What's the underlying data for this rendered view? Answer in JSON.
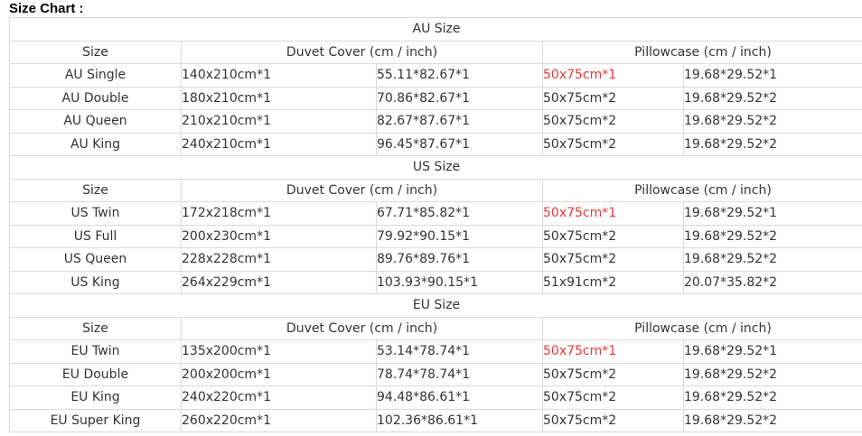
{
  "title": "Size Chart :",
  "header": {
    "size": "Size",
    "duvet": "Duvet Cover (cm / inch)",
    "pillow": "Pillowcase (cm / inch)"
  },
  "sections": [
    {
      "name": "AU Size",
      "rows": [
        {
          "size": "AU Single",
          "duvet_cm": "140x210cm*1",
          "duvet_in": "55.11*82.67*1",
          "pillow_cm": "50x75cm*1",
          "pillow_in": "19.68*29.52*1",
          "pillow_cm_highlight": true
        },
        {
          "size": "AU Double",
          "duvet_cm": "180x210cm*1",
          "duvet_in": "70.86*82.67*1",
          "pillow_cm": "50x75cm*2",
          "pillow_in": "19.68*29.52*2",
          "pillow_cm_highlight": false
        },
        {
          "size": "AU Queen",
          "duvet_cm": "210x210cm*1",
          "duvet_in": "82.67*87.67*1",
          "pillow_cm": "50x75cm*2",
          "pillow_in": "19.68*29.52*2",
          "pillow_cm_highlight": false
        },
        {
          "size": "AU King",
          "duvet_cm": "240x210cm*1",
          "duvet_in": "96.45*87.67*1",
          "pillow_cm": "50x75cm*2",
          "pillow_in": "19.68*29.52*2",
          "pillow_cm_highlight": false
        }
      ]
    },
    {
      "name": "US Size",
      "rows": [
        {
          "size": "US Twin",
          "duvet_cm": "172x218cm*1",
          "duvet_in": "67.71*85.82*1",
          "pillow_cm": "50x75cm*1",
          "pillow_in": "19.68*29.52*1",
          "pillow_cm_highlight": true
        },
        {
          "size": "US Full",
          "duvet_cm": "200x230cm*1",
          "duvet_in": "79.92*90.15*1",
          "pillow_cm": "50x75cm*2",
          "pillow_in": "19.68*29.52*2",
          "pillow_cm_highlight": false
        },
        {
          "size": "US Queen",
          "duvet_cm": "228x228cm*1",
          "duvet_in": "89.76*89.76*1",
          "pillow_cm": "50x75cm*2",
          "pillow_in": "19.68*29.52*2",
          "pillow_cm_highlight": false
        },
        {
          "size": "US King",
          "duvet_cm": "264x229cm*1",
          "duvet_in": "103.93*90.15*1",
          "pillow_cm": "51x91cm*2",
          "pillow_in": "20.07*35.82*2",
          "pillow_cm_highlight": false
        }
      ]
    },
    {
      "name": "EU Size",
      "rows": [
        {
          "size": "EU Twin",
          "duvet_cm": "135x200cm*1",
          "duvet_in": "53.14*78.74*1",
          "pillow_cm": "50x75cm*1",
          "pillow_in": "19.68*29.52*1",
          "pillow_cm_highlight": true
        },
        {
          "size": "EU Double",
          "duvet_cm": "200x200cm*1",
          "duvet_in": "78.74*78.74*1",
          "pillow_cm": "50x75cm*2",
          "pillow_in": "19.68*29.52*2",
          "pillow_cm_highlight": false
        },
        {
          "size": "EU King",
          "duvet_cm": "240x220cm*1",
          "duvet_in": "94.48*86.61*1",
          "pillow_cm": "50x75cm*2",
          "pillow_in": "19.68*29.52*2",
          "pillow_cm_highlight": false
        },
        {
          "size": "EU Super King",
          "duvet_cm": "260x220cm*1",
          "duvet_in": "102.36*86.61*1",
          "pillow_cm": "50x75cm*2",
          "pillow_in": "19.68*29.52*2",
          "pillow_cm_highlight": false
        }
      ]
    }
  ],
  "colors": {
    "text": "#333333",
    "highlight": "#e53935",
    "border": "#d9d9d9"
  }
}
